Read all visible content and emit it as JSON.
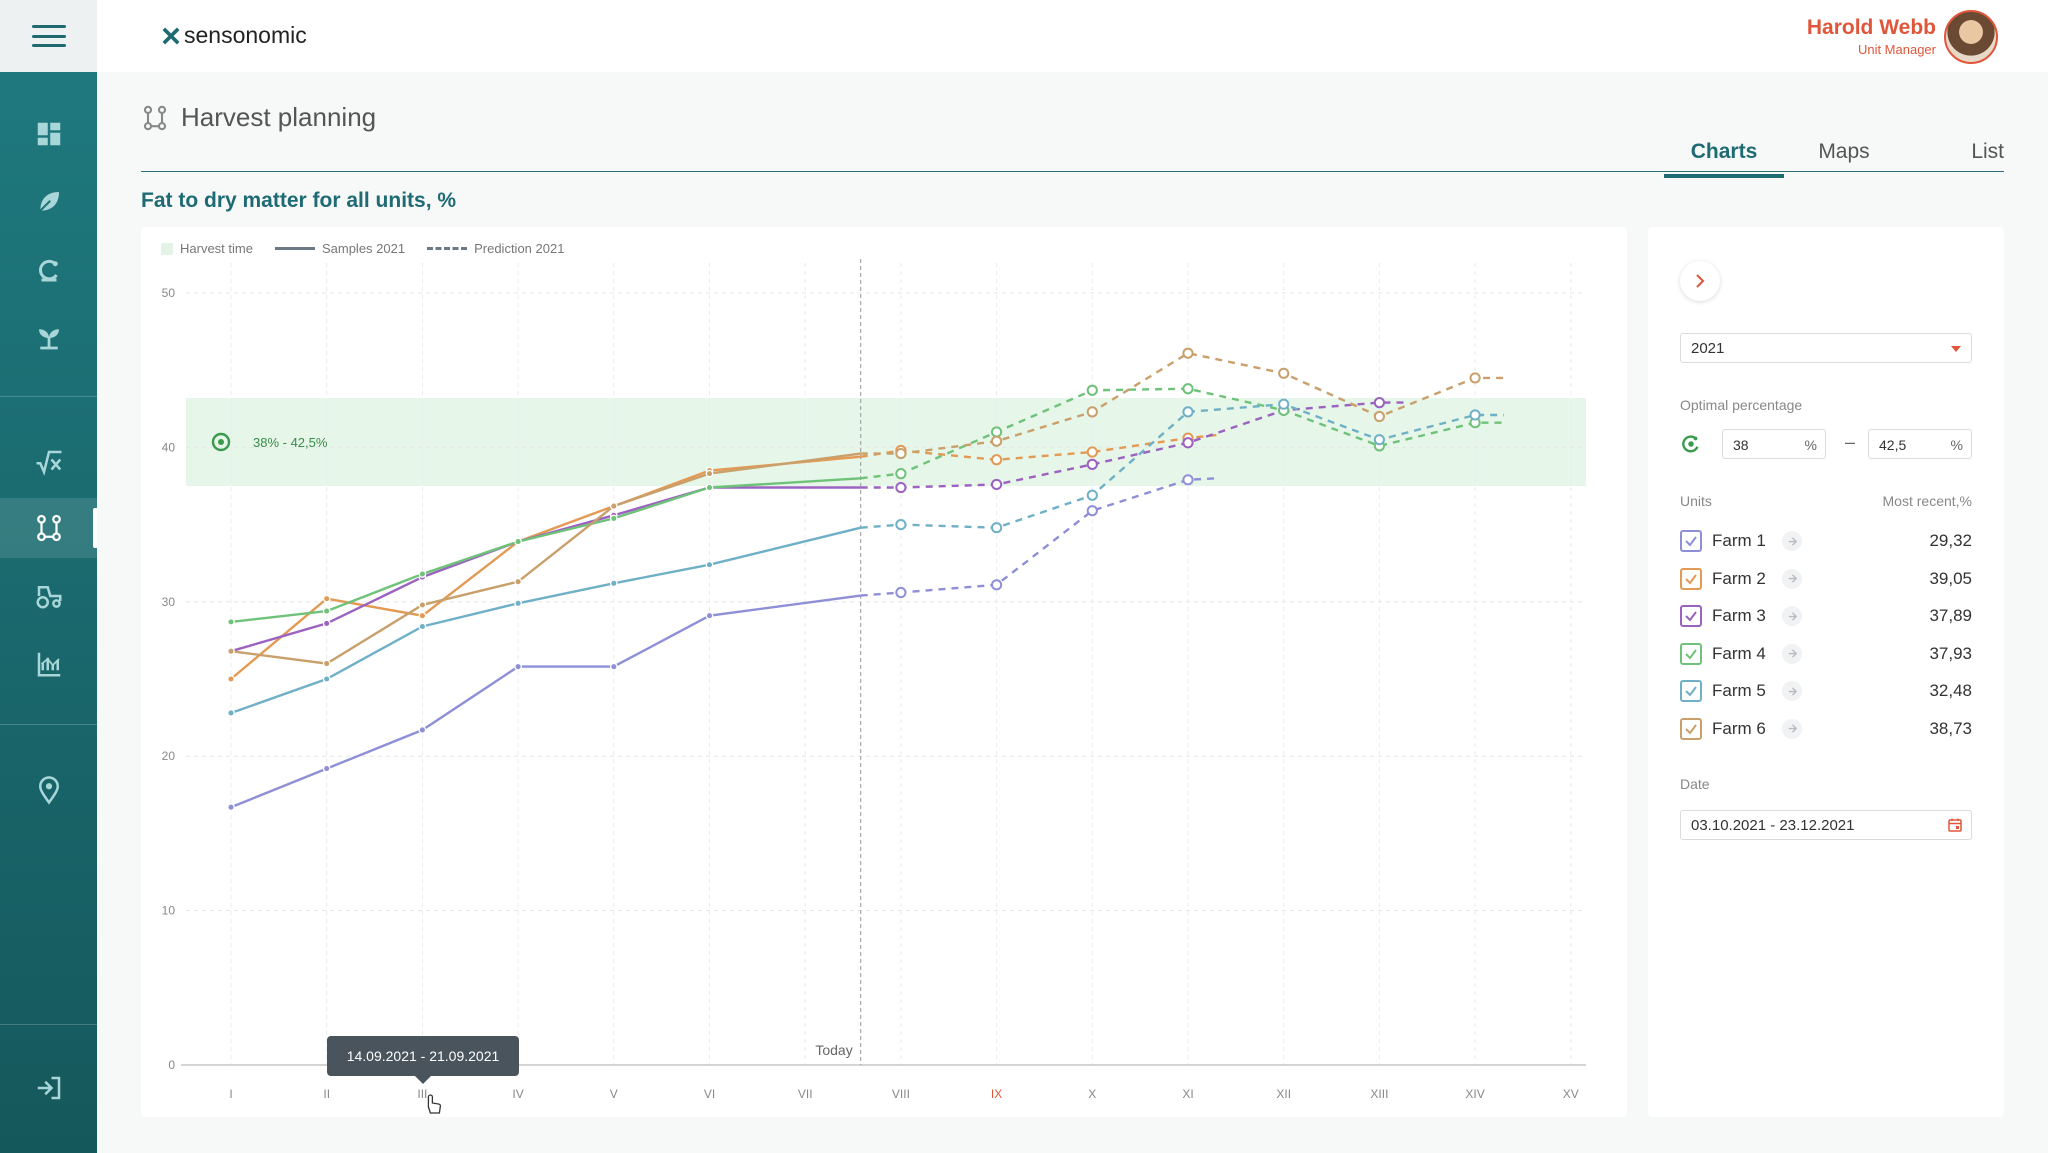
{
  "app": {
    "logo_text": "sensonomic"
  },
  "user": {
    "name": "Harold Webb",
    "role": "Unit Manager"
  },
  "page": {
    "title": "Harvest planning"
  },
  "tabs": [
    {
      "label": "Charts"
    },
    {
      "label": "Maps"
    },
    {
      "label": "List"
    }
  ],
  "section": {
    "title": "Fat to dry matter for all units, %"
  },
  "legend": {
    "harvest": "Harvest time",
    "samples": "Samples 2021",
    "prediction": "Prediction 2021"
  },
  "tooltip": {
    "text": "14.09.2021 - 21.09.2021"
  },
  "panel": {
    "year": "2021",
    "optimal_label": "Optimal percentage",
    "optimal_min": "38",
    "optimal_max": "42,5",
    "percent_sign": "%",
    "dash": "–",
    "units_label": "Units",
    "recent_label": "Most recent,%",
    "units": [
      {
        "name": "Farm 1",
        "value": "29,32",
        "color": "#8e8fd6"
      },
      {
        "name": "Farm 2",
        "value": "39,05",
        "color": "#e39a55"
      },
      {
        "name": "Farm 3",
        "value": "37,89",
        "color": "#9b62c0"
      },
      {
        "name": "Farm 4",
        "value": "37,93",
        "color": "#6fc27a"
      },
      {
        "name": "Farm 5",
        "value": "32,48",
        "color": "#6fb0c6"
      },
      {
        "name": "Farm 6",
        "value": "38,73",
        "color": "#c9a06b"
      }
    ],
    "date_label": "Date",
    "date_range": "03.10.2021 - 23.12.2021"
  },
  "chart_data": {
    "type": "line",
    "categories": [
      "I",
      "II",
      "III",
      "IV",
      "V",
      "VI",
      "VII",
      "VIII",
      "IX",
      "X",
      "XI",
      "XII",
      "XIII",
      "XIV",
      "XV"
    ],
    "highlight_category": "IX",
    "ylim": [
      0,
      50
    ],
    "yticks": [
      0,
      10,
      20,
      30,
      40,
      50
    ],
    "today_position": 6.58,
    "today_label": "Today",
    "harvest_band": {
      "from": 37.5,
      "to": 43.2,
      "label": "38% - 42,5%"
    },
    "grid": true,
    "series": [
      {
        "name": "Farm 1",
        "color": "#8e8fd6",
        "samples": [
          [
            0,
            16.7
          ],
          [
            1,
            19.2
          ],
          [
            2,
            21.7
          ],
          [
            3,
            25.8
          ],
          [
            4,
            25.8
          ],
          [
            5,
            29.1
          ],
          [
            6.58,
            30.4
          ]
        ],
        "prediction": [
          [
            6.58,
            30.4
          ],
          [
            7,
            30.6
          ],
          [
            8,
            31.1
          ],
          [
            9,
            35.9
          ],
          [
            10,
            37.9
          ],
          [
            10.3,
            38.0
          ]
        ]
      },
      {
        "name": "Farm 2",
        "color": "#e39a55",
        "samples": [
          [
            0,
            25.0
          ],
          [
            1,
            30.2
          ],
          [
            2,
            29.1
          ],
          [
            3,
            33.9
          ],
          [
            4,
            36.2
          ],
          [
            5,
            38.5
          ],
          [
            6.58,
            39.4
          ]
        ],
        "prediction": [
          [
            6.58,
            39.4
          ],
          [
            7,
            39.8
          ],
          [
            8,
            39.2
          ],
          [
            9,
            39.7
          ],
          [
            10,
            40.6
          ],
          [
            10.3,
            40.8
          ]
        ]
      },
      {
        "name": "Farm 3",
        "color": "#9b62c0",
        "samples": [
          [
            0,
            26.8
          ],
          [
            1,
            28.6
          ],
          [
            2,
            31.6
          ],
          [
            3,
            33.9
          ],
          [
            4,
            35.6
          ],
          [
            5,
            37.4
          ],
          [
            6.58,
            37.4
          ]
        ],
        "prediction": [
          [
            6.58,
            37.4
          ],
          [
            7,
            37.4
          ],
          [
            8,
            37.6
          ],
          [
            9,
            38.9
          ],
          [
            10,
            40.3
          ],
          [
            11,
            42.4
          ],
          [
            12,
            42.9
          ],
          [
            12.3,
            42.9
          ]
        ]
      },
      {
        "name": "Farm 4",
        "color": "#6fc27a",
        "samples": [
          [
            0,
            28.7
          ],
          [
            1,
            29.4
          ],
          [
            2,
            31.8
          ],
          [
            3,
            33.9
          ],
          [
            4,
            35.4
          ],
          [
            5,
            37.4
          ],
          [
            6.58,
            38.0
          ]
        ],
        "prediction": [
          [
            6.58,
            38.0
          ],
          [
            7,
            38.3
          ],
          [
            8,
            41.0
          ],
          [
            9,
            43.7
          ],
          [
            10,
            43.8
          ],
          [
            11,
            42.4
          ],
          [
            12,
            40.1
          ],
          [
            13,
            41.6
          ],
          [
            13.3,
            41.6
          ]
        ]
      },
      {
        "name": "Farm 5",
        "color": "#6fb0c6",
        "samples": [
          [
            0,
            22.8
          ],
          [
            1,
            25.0
          ],
          [
            2,
            28.4
          ],
          [
            3,
            29.9
          ],
          [
            4,
            31.2
          ],
          [
            5,
            32.4
          ],
          [
            6.58,
            34.8
          ]
        ],
        "prediction": [
          [
            6.58,
            34.8
          ],
          [
            7,
            35.0
          ],
          [
            8,
            34.8
          ],
          [
            9,
            36.9
          ],
          [
            10,
            42.3
          ],
          [
            11,
            42.8
          ],
          [
            12,
            40.5
          ],
          [
            13,
            42.1
          ],
          [
            13.3,
            42.1
          ]
        ]
      },
      {
        "name": "Farm 6",
        "color": "#c9a06b",
        "samples": [
          [
            0,
            26.8
          ],
          [
            1,
            26.0
          ],
          [
            2,
            29.8
          ],
          [
            3,
            31.3
          ],
          [
            4,
            36.2
          ],
          [
            5,
            38.3
          ],
          [
            6.58,
            39.6
          ]
        ],
        "prediction": [
          [
            6.58,
            39.6
          ],
          [
            7,
            39.6
          ],
          [
            8,
            40.4
          ],
          [
            9,
            42.3
          ],
          [
            10,
            46.1
          ],
          [
            11,
            44.8
          ],
          [
            12,
            42.0
          ],
          [
            13,
            44.5
          ],
          [
            13.3,
            44.5
          ]
        ]
      }
    ]
  }
}
